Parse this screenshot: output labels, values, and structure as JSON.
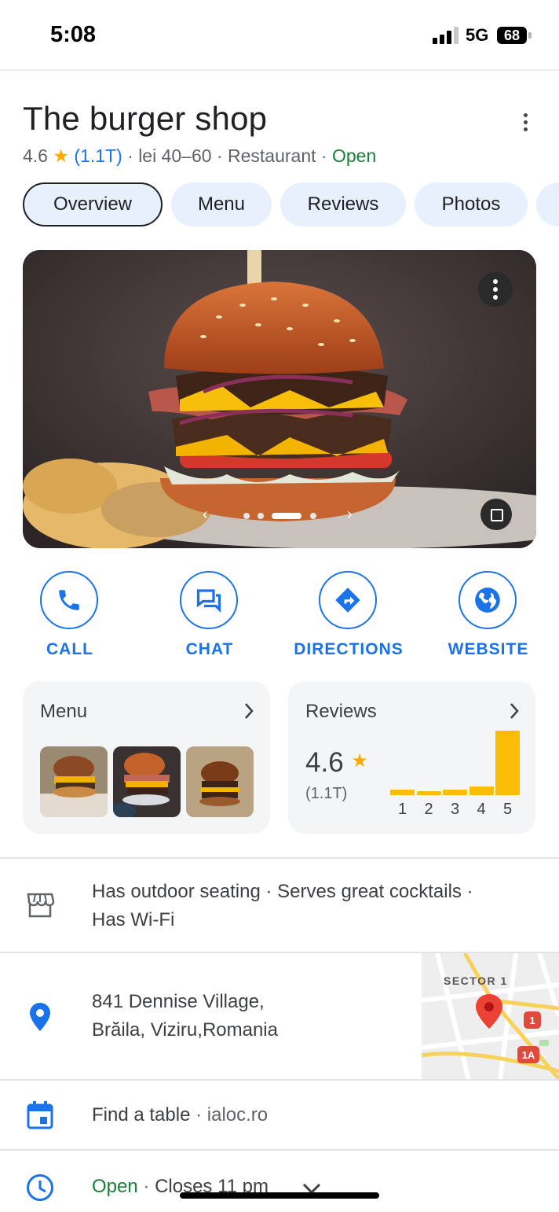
{
  "status_bar": {
    "time": "5:08",
    "network": "5G",
    "battery": "68"
  },
  "place": {
    "name": "The burger shop",
    "rating": "4.6",
    "review_count": "(1.1T)",
    "price": "lei 40–60",
    "category": "Restaurant",
    "status": "Open"
  },
  "tabs": [
    {
      "label": "Overview"
    },
    {
      "label": "Menu"
    },
    {
      "label": "Reviews"
    },
    {
      "label": "Photos"
    }
  ],
  "actions": {
    "call": "CALL",
    "chat": "CHAT",
    "directions": "DIRECTIONS",
    "website": "WEBSITE"
  },
  "menu_card": {
    "title": "Menu"
  },
  "reviews_card": {
    "title": "Reviews",
    "rating": "4.6",
    "count": "(1.1T)",
    "histogram": [
      {
        "stars": "1",
        "fraction": 0.08
      },
      {
        "stars": "2",
        "fraction": 0.06
      },
      {
        "stars": "3",
        "fraction": 0.08
      },
      {
        "stars": "4",
        "fraction": 0.14
      },
      {
        "stars": "5",
        "fraction": 1.0
      }
    ]
  },
  "amenities": {
    "line1": "Has outdoor seating · Serves great cocktails ·",
    "line2": "Has Wi-Fi"
  },
  "address": {
    "line1": "841 Dennise Village,",
    "line2": "Brăila, Viziru,Romania",
    "map_label": "SECTOR 1",
    "map_shield_1": "1",
    "map_shield_2": "1A"
  },
  "reservation": {
    "text": "Find a table",
    "source": "ialoc.ro"
  },
  "hours": {
    "status": "Open",
    "closes": "Closes 11 pm"
  },
  "colors": {
    "accent": "#1a73e8",
    "open_green": "#188038",
    "star": "#fbbc04",
    "pin_red": "#ea4335"
  },
  "icons": [
    "phone-icon",
    "chat-icon",
    "directions-icon",
    "globe-icon",
    "storefront-icon",
    "location-pin-icon",
    "calendar-icon",
    "clock-icon",
    "chevron-right-icon",
    "chevron-down-icon",
    "more-vert-icon",
    "expand-icon"
  ]
}
